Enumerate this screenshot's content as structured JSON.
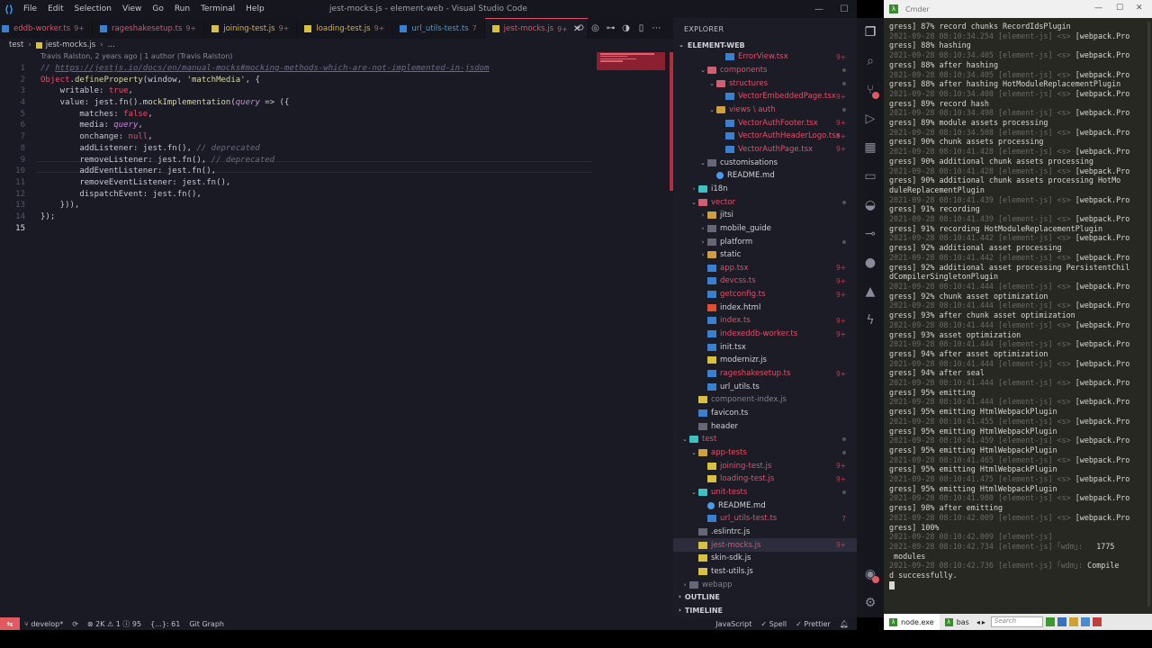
{
  "vscode": {
    "menu": [
      "File",
      "Edit",
      "Selection",
      "View",
      "Go",
      "Run",
      "Terminal",
      "Help"
    ],
    "window_title": "jest-mocks.js - element-web - Visual Studio Code",
    "tabs": [
      {
        "label": "eddb-worker.ts",
        "mod": "9+",
        "color": "red"
      },
      {
        "label": "rageshakesetup.ts",
        "mod": "9+",
        "color": "red"
      },
      {
        "label": "joining-test.js",
        "mod": "9+",
        "color": "yellow"
      },
      {
        "label": "loading-test.js",
        "mod": "9+",
        "color": "yellow"
      },
      {
        "label": "url_utils-test.ts",
        "mod": "7",
        "color": "blue"
      },
      {
        "label": "jest-mocks.js",
        "mod": "9+",
        "color": "red",
        "active": true
      }
    ],
    "breadcrumb": [
      "test",
      "jest-mocks.js",
      "..."
    ],
    "blame": "Travis Ralston, 2 years ago | 1 author (Travis Ralston)",
    "code_lines": [
      {
        "n": "1",
        "text": "// https://jestjs.io/docs/en/manual-mocks#mocking-methods-which-are-not-implemented-in-jsdom"
      },
      {
        "n": "2",
        "text": "Object.defineProperty(window, 'matchMedia', {"
      },
      {
        "n": "3",
        "text": "    writable: true,"
      },
      {
        "n": "4",
        "text": "    value: jest.fn().mockImplementation(query => ({"
      },
      {
        "n": "5",
        "text": "        matches: false,"
      },
      {
        "n": "6",
        "text": "        media: query,"
      },
      {
        "n": "7",
        "text": "        onchange: null,"
      },
      {
        "n": "8",
        "text": "        addListener: jest.fn(), // deprecated"
      },
      {
        "n": "9",
        "text": "        removeListener: jest.fn(), // deprecated"
      },
      {
        "n": "10",
        "text": "        addEventListener: jest.fn(),"
      },
      {
        "n": "11",
        "text": "        removeEventListener: jest.fn(),"
      },
      {
        "n": "12",
        "text": "        dispatchEvent: jest.fn(),"
      },
      {
        "n": "13",
        "text": "    })),"
      },
      {
        "n": "14",
        "text": "});"
      },
      {
        "n": "15",
        "text": ""
      }
    ]
  },
  "explorer": {
    "title": "EXPLORER",
    "root": "ELEMENT-WEB",
    "outline": "OUTLINE",
    "timeline": "TIMELINE",
    "items": [
      {
        "label": "ErrorView.tsx",
        "indent": 4,
        "icon": "ts",
        "color": "red",
        "badge": "9+"
      },
      {
        "label": "components",
        "indent": 2,
        "icon": "folder-red",
        "color": "red",
        "twisty": "v",
        "dot": true
      },
      {
        "label": "structures",
        "indent": 3,
        "icon": "folder-red",
        "color": "red",
        "twisty": "v",
        "dot": true
      },
      {
        "label": "VectorEmbeddedPage.tsx",
        "indent": 4,
        "icon": "ts",
        "color": "red",
        "badge": "9+"
      },
      {
        "label": "views \\ auth",
        "indent": 3,
        "icon": "folder",
        "color": "red",
        "twisty": "v",
        "dot": true
      },
      {
        "label": "VectorAuthFooter.tsx",
        "indent": 4,
        "icon": "ts",
        "color": "red",
        "badge": "9+"
      },
      {
        "label": "VectorAuthHeaderLogo.tsx",
        "indent": 4,
        "icon": "ts",
        "color": "red",
        "badge": "9+"
      },
      {
        "label": "VectorAuthPage.tsx",
        "indent": 4,
        "icon": "ts",
        "color": "red",
        "badge": "9+"
      },
      {
        "label": "customisations",
        "indent": 2,
        "icon": "grey",
        "color": "white",
        "twisty": "v"
      },
      {
        "label": "README.md",
        "indent": 3,
        "icon": "info",
        "color": "white"
      },
      {
        "label": "i18n",
        "indent": 1,
        "icon": "folder-teal",
        "color": "white",
        "twisty": ">"
      },
      {
        "label": "vector",
        "indent": 1,
        "icon": "folder-red",
        "color": "red",
        "twisty": "v",
        "dot": true
      },
      {
        "label": "jitsi",
        "indent": 2,
        "icon": "folder",
        "color": "white",
        "twisty": ">"
      },
      {
        "label": "mobile_guide",
        "indent": 2,
        "icon": "grey",
        "color": "white",
        "twisty": ">"
      },
      {
        "label": "platform",
        "indent": 2,
        "icon": "grey",
        "color": "white",
        "twisty": ">",
        "dot": true
      },
      {
        "label": "static",
        "indent": 2,
        "icon": "folder",
        "color": "white",
        "twisty": ">"
      },
      {
        "label": "app.tsx",
        "indent": 2,
        "icon": "ts",
        "color": "red",
        "badge": "9+"
      },
      {
        "label": "devcss.ts",
        "indent": 2,
        "icon": "ts",
        "color": "red",
        "badge": "9+"
      },
      {
        "label": "getconfig.ts",
        "indent": 2,
        "icon": "ts",
        "color": "red",
        "badge": "9+"
      },
      {
        "label": "index.html",
        "indent": 2,
        "icon": "html",
        "color": "white"
      },
      {
        "label": "index.ts",
        "indent": 2,
        "icon": "ts",
        "color": "red",
        "badge": "9+"
      },
      {
        "label": "indexeddb-worker.ts",
        "indent": 2,
        "icon": "ts",
        "color": "red",
        "badge": "9+"
      },
      {
        "label": "init.tsx",
        "indent": 2,
        "icon": "ts",
        "color": "white"
      },
      {
        "label": "modernizr.js",
        "indent": 2,
        "icon": "js",
        "color": "white"
      },
      {
        "label": "rageshakesetup.ts",
        "indent": 2,
        "icon": "ts",
        "color": "red",
        "badge": "9+"
      },
      {
        "label": "url_utils.ts",
        "indent": 2,
        "icon": "ts",
        "color": "white"
      },
      {
        "label": "component-index.js",
        "indent": 1,
        "icon": "js",
        "color": "grey"
      },
      {
        "label": "favicon.ts",
        "indent": 1,
        "icon": "ts",
        "color": "white"
      },
      {
        "label": "header",
        "indent": 1,
        "icon": "grey",
        "color": "white"
      },
      {
        "label": "test",
        "indent": 0,
        "icon": "folder-teal",
        "color": "red",
        "twisty": "v",
        "dot": true
      },
      {
        "label": "app-tests",
        "indent": 1,
        "icon": "folder",
        "color": "red",
        "twisty": "v",
        "dot": true
      },
      {
        "label": "joining-test.js",
        "indent": 2,
        "icon": "js",
        "color": "red",
        "badge": "9+"
      },
      {
        "label": "loading-test.js",
        "indent": 2,
        "icon": "js",
        "color": "red",
        "badge": "9+"
      },
      {
        "label": "unit-tests",
        "indent": 1,
        "icon": "folder-teal",
        "color": "red",
        "twisty": "v",
        "dot": true
      },
      {
        "label": "README.md",
        "indent": 2,
        "icon": "info",
        "color": "white"
      },
      {
        "label": "url_utils-test.ts",
        "indent": 2,
        "icon": "ts",
        "color": "red",
        "badge": "7"
      },
      {
        "label": ".eslintrc.js",
        "indent": 1,
        "icon": "grey",
        "color": "white"
      },
      {
        "label": "jest-mocks.js",
        "indent": 1,
        "icon": "js",
        "color": "red",
        "badge": "9+",
        "selected": true
      },
      {
        "label": "skin-sdk.js",
        "indent": 1,
        "icon": "js",
        "color": "white"
      },
      {
        "label": "test-utils.js",
        "indent": 1,
        "icon": "js",
        "color": "white"
      },
      {
        "label": "webapp",
        "indent": 0,
        "icon": "grey",
        "color": "grey",
        "twisty": ">"
      }
    ]
  },
  "statusbar": {
    "branch": "develop*",
    "problems": "⊗ 2K ⚠ 1 ⓘ 95",
    "braces": "{...}: 61",
    "gitgraph": "Git Graph",
    "language": "JavaScript",
    "spell": "Spell",
    "prettier": "Prettier"
  },
  "cmder": {
    "title": "Cmder",
    "lines": [
      [
        "",
        "gress] 87% record chunks RecordIdsPlugin"
      ],
      [
        "2021-09-28 08:10:34.254 [element-js] <s> ",
        "[webpack.Pro"
      ],
      [
        "",
        "gress] 88% hashing"
      ],
      [
        "2021-09-28 08:10:34.405 [element-js] <s> ",
        "[webpack.Pro"
      ],
      [
        "",
        "gress] 88% after hashing"
      ],
      [
        "2021-09-28 08:10:34.405 [element-js] <s> ",
        "[webpack.Pro"
      ],
      [
        "",
        "gress] 88% after hashing HotModuleReplacementPlugin"
      ],
      [
        "2021-09-28 08:10:34.408 [element-js] <s> ",
        "[webpack.Pro"
      ],
      [
        "",
        "gress] 89% record hash"
      ],
      [
        "2021-09-28 08:10:34.498 [element-js] <s> ",
        "[webpack.Pro"
      ],
      [
        "",
        "gress] 89% module assets processing"
      ],
      [
        "2021-09-28 08:10:34.508 [element-js] <s> ",
        "[webpack.Pro"
      ],
      [
        "",
        "gress] 90% chunk assets processing"
      ],
      [
        "2021-09-28 08:10:41.428 [element-js] <s> ",
        "[webpack.Pro"
      ],
      [
        "",
        "gress] 90% additional chunk assets processing"
      ],
      [
        "2021-09-28 08:10:41.428 [element-js] <s> ",
        "[webpack.Pro"
      ],
      [
        "",
        "gress] 90% additional chunk assets processing HotMo"
      ],
      [
        "",
        "duleReplacementPlugin"
      ],
      [
        "2021-09-28 08:10:41.439 [element-js] <s> ",
        "[webpack.Pro"
      ],
      [
        "",
        "gress] 91% recording"
      ],
      [
        "2021-09-28 08:10:41.439 [element-js] <s> ",
        "[webpack.Pro"
      ],
      [
        "",
        "gress] 91% recording HotModuleReplacementPlugin"
      ],
      [
        "2021-09-28 08:10:41.442 [element-js] <s> ",
        "[webpack.Pro"
      ],
      [
        "",
        "gress] 92% additional asset processing"
      ],
      [
        "2021-09-28 08:10:41.442 [element-js] <s> ",
        "[webpack.Pro"
      ],
      [
        "",
        "gress] 92% additional asset processing PersistentChil"
      ],
      [
        "",
        "dCompilerSingletonPlugin"
      ],
      [
        "2021-09-28 08:10:41.444 [element-js] <s> ",
        "[webpack.Pro"
      ],
      [
        "",
        "gress] 92% chunk asset optimization"
      ],
      [
        "2021-09-28 08:10:41.444 [element-js] <s> ",
        "[webpack.Pro"
      ],
      [
        "",
        "gress] 93% after chunk asset optimization"
      ],
      [
        "2021-09-28 08:10:41.444 [element-js] <s> ",
        "[webpack.Pro"
      ],
      [
        "",
        "gress] 93% asset optimization"
      ],
      [
        "2021-09-28 08:10:41.444 [element-js] <s> ",
        "[webpack.Pro"
      ],
      [
        "",
        "gress] 94% after asset optimization"
      ],
      [
        "2021-09-28 08:10:41.444 [element-js] <s> ",
        "[webpack.Pro"
      ],
      [
        "",
        "gress] 94% after seal"
      ],
      [
        "2021-09-28 08:10:41.444 [element-js] <s> ",
        "[webpack.Pro"
      ],
      [
        "",
        "gress] 95% emitting"
      ],
      [
        "2021-09-28 08:10:41.444 [element-js] <s> ",
        "[webpack.Pro"
      ],
      [
        "",
        "gress] 95% emitting HtmlWebpackPlugin"
      ],
      [
        "2021-09-28 08:10:41.455 [element-js] <s> ",
        "[webpack.Pro"
      ],
      [
        "",
        "gress] 95% emitting HtmlWebpackPlugin"
      ],
      [
        "2021-09-28 08:10:41.459 [element-js] <s> ",
        "[webpack.Pro"
      ],
      [
        "",
        "gress] 95% emitting HtmlWebpackPlugin"
      ],
      [
        "2021-09-28 08:10:41.465 [element-js] <s> ",
        "[webpack.Pro"
      ],
      [
        "",
        "gress] 95% emitting HtmlWebpackPlugin"
      ],
      [
        "2021-09-28 08:10:41.475 [element-js] <s> ",
        "[webpack.Pro"
      ],
      [
        "",
        "gress] 95% emitting HtmlWebpackPlugin"
      ],
      [
        "2021-09-28 08:10:41.980 [element-js] <s> ",
        "[webpack.Pro"
      ],
      [
        "",
        "gress] 98% after emitting"
      ],
      [
        "2021-09-28 08:10:42.009 [element-js] <s> ",
        "[webpack.Pro"
      ],
      [
        "",
        "gress] 100%"
      ],
      [
        "2021-09-28 08:10:42.009 [element-js] ",
        ""
      ],
      [
        "2021-09-28 08:10:42.734 [element-js] ｢wdm｣: ",
        "  1775"
      ],
      [
        "",
        " modules"
      ],
      [
        "2021-09-28 08:10:42.736 [element-js] ｢wdm｣: ",
        "Compile"
      ],
      [
        "",
        "d successfully."
      ]
    ],
    "tab1": "node.exe",
    "tab2": "bas",
    "search_placeholder": "Search"
  }
}
